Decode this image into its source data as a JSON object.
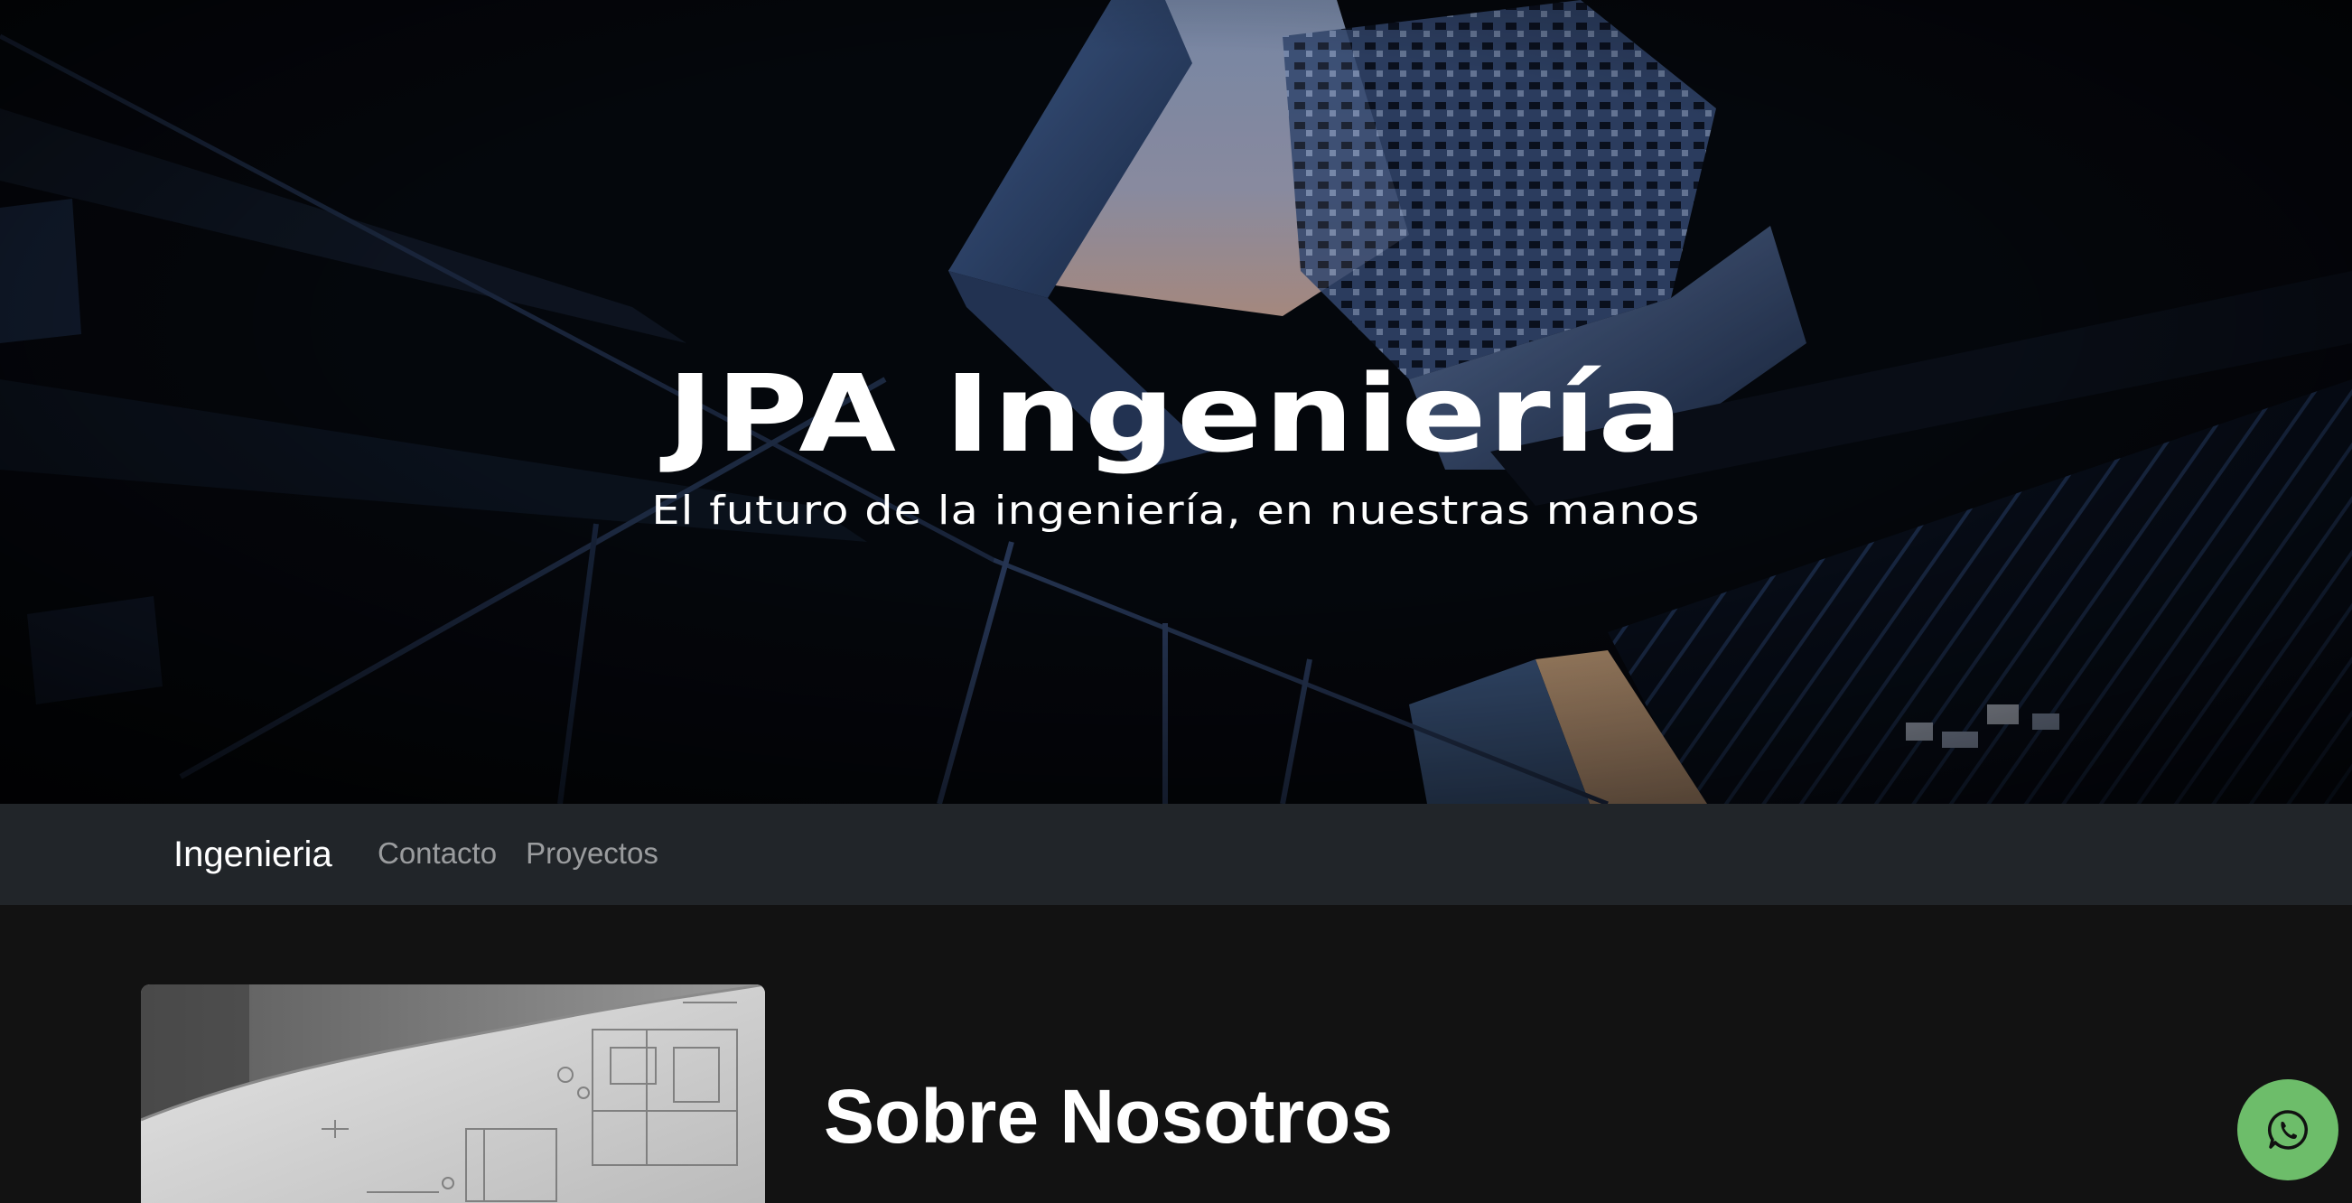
{
  "hero": {
    "title": "JPA Ingeniería",
    "subtitle": "El futuro de la ingeniería, en nuestras manos"
  },
  "navbar": {
    "brand": "Ingenieria",
    "links": [
      {
        "label": "Contacto"
      },
      {
        "label": "Proyectos"
      }
    ]
  },
  "about": {
    "title": "Sobre Nosotros"
  },
  "floating": {
    "icon": "whatsapp-icon",
    "color": "#6dbd6a"
  },
  "colors": {
    "navbar_bg": "#212529",
    "page_bg": "#121212",
    "text": "#ffffff",
    "nav_link": "rgba(255,255,255,0.55)"
  }
}
